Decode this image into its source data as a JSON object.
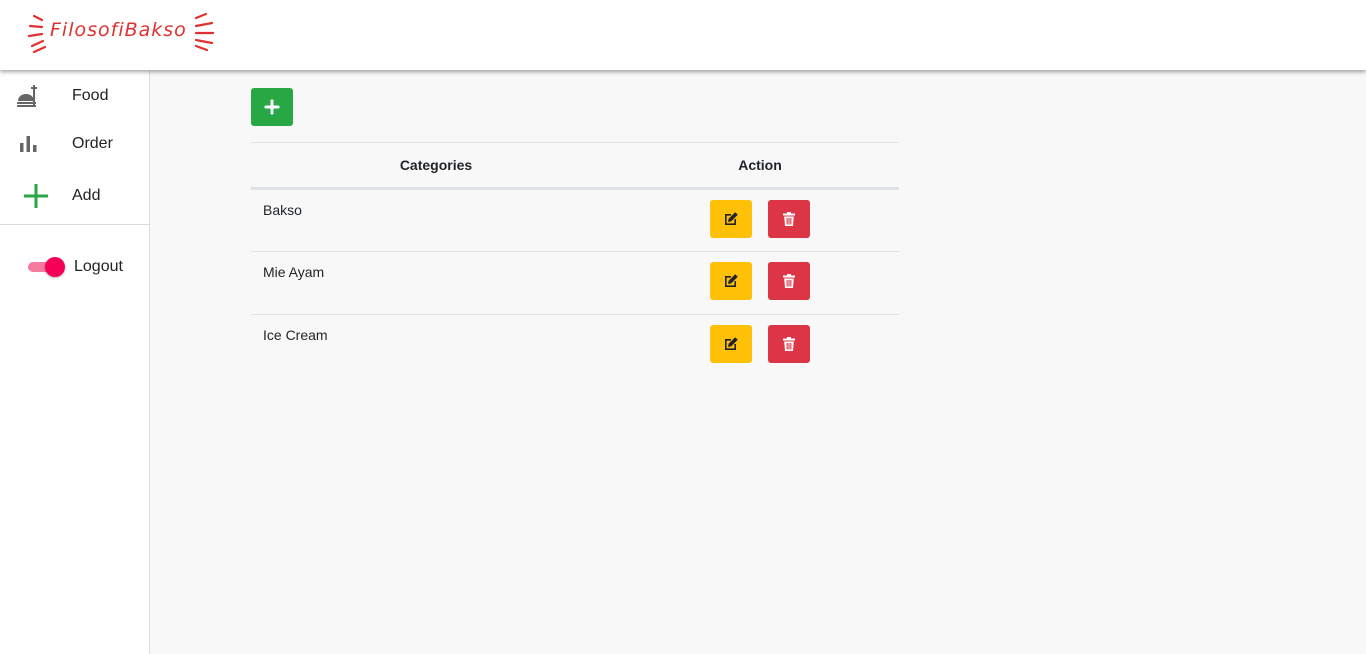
{
  "header": {
    "logo_text": "FilosofiBakso"
  },
  "sidebar": {
    "items": [
      {
        "label": "Food",
        "icon": "food-tray-icon"
      },
      {
        "label": "Order",
        "icon": "bar-chart-icon"
      },
      {
        "label": "Add",
        "icon": "plus-icon"
      }
    ],
    "logout": {
      "label": "Logout",
      "toggle_on": true
    }
  },
  "table": {
    "headers": [
      "Categories",
      "Action"
    ],
    "rows": [
      {
        "category": "Bakso"
      },
      {
        "category": "Mie Ayam"
      },
      {
        "category": "Ice Cream"
      }
    ]
  },
  "colors": {
    "add_button": "#28a745",
    "edit_button": "#ffc107",
    "delete_button": "#dc3545",
    "logo": "#e03030",
    "toggle": "#f50057"
  }
}
